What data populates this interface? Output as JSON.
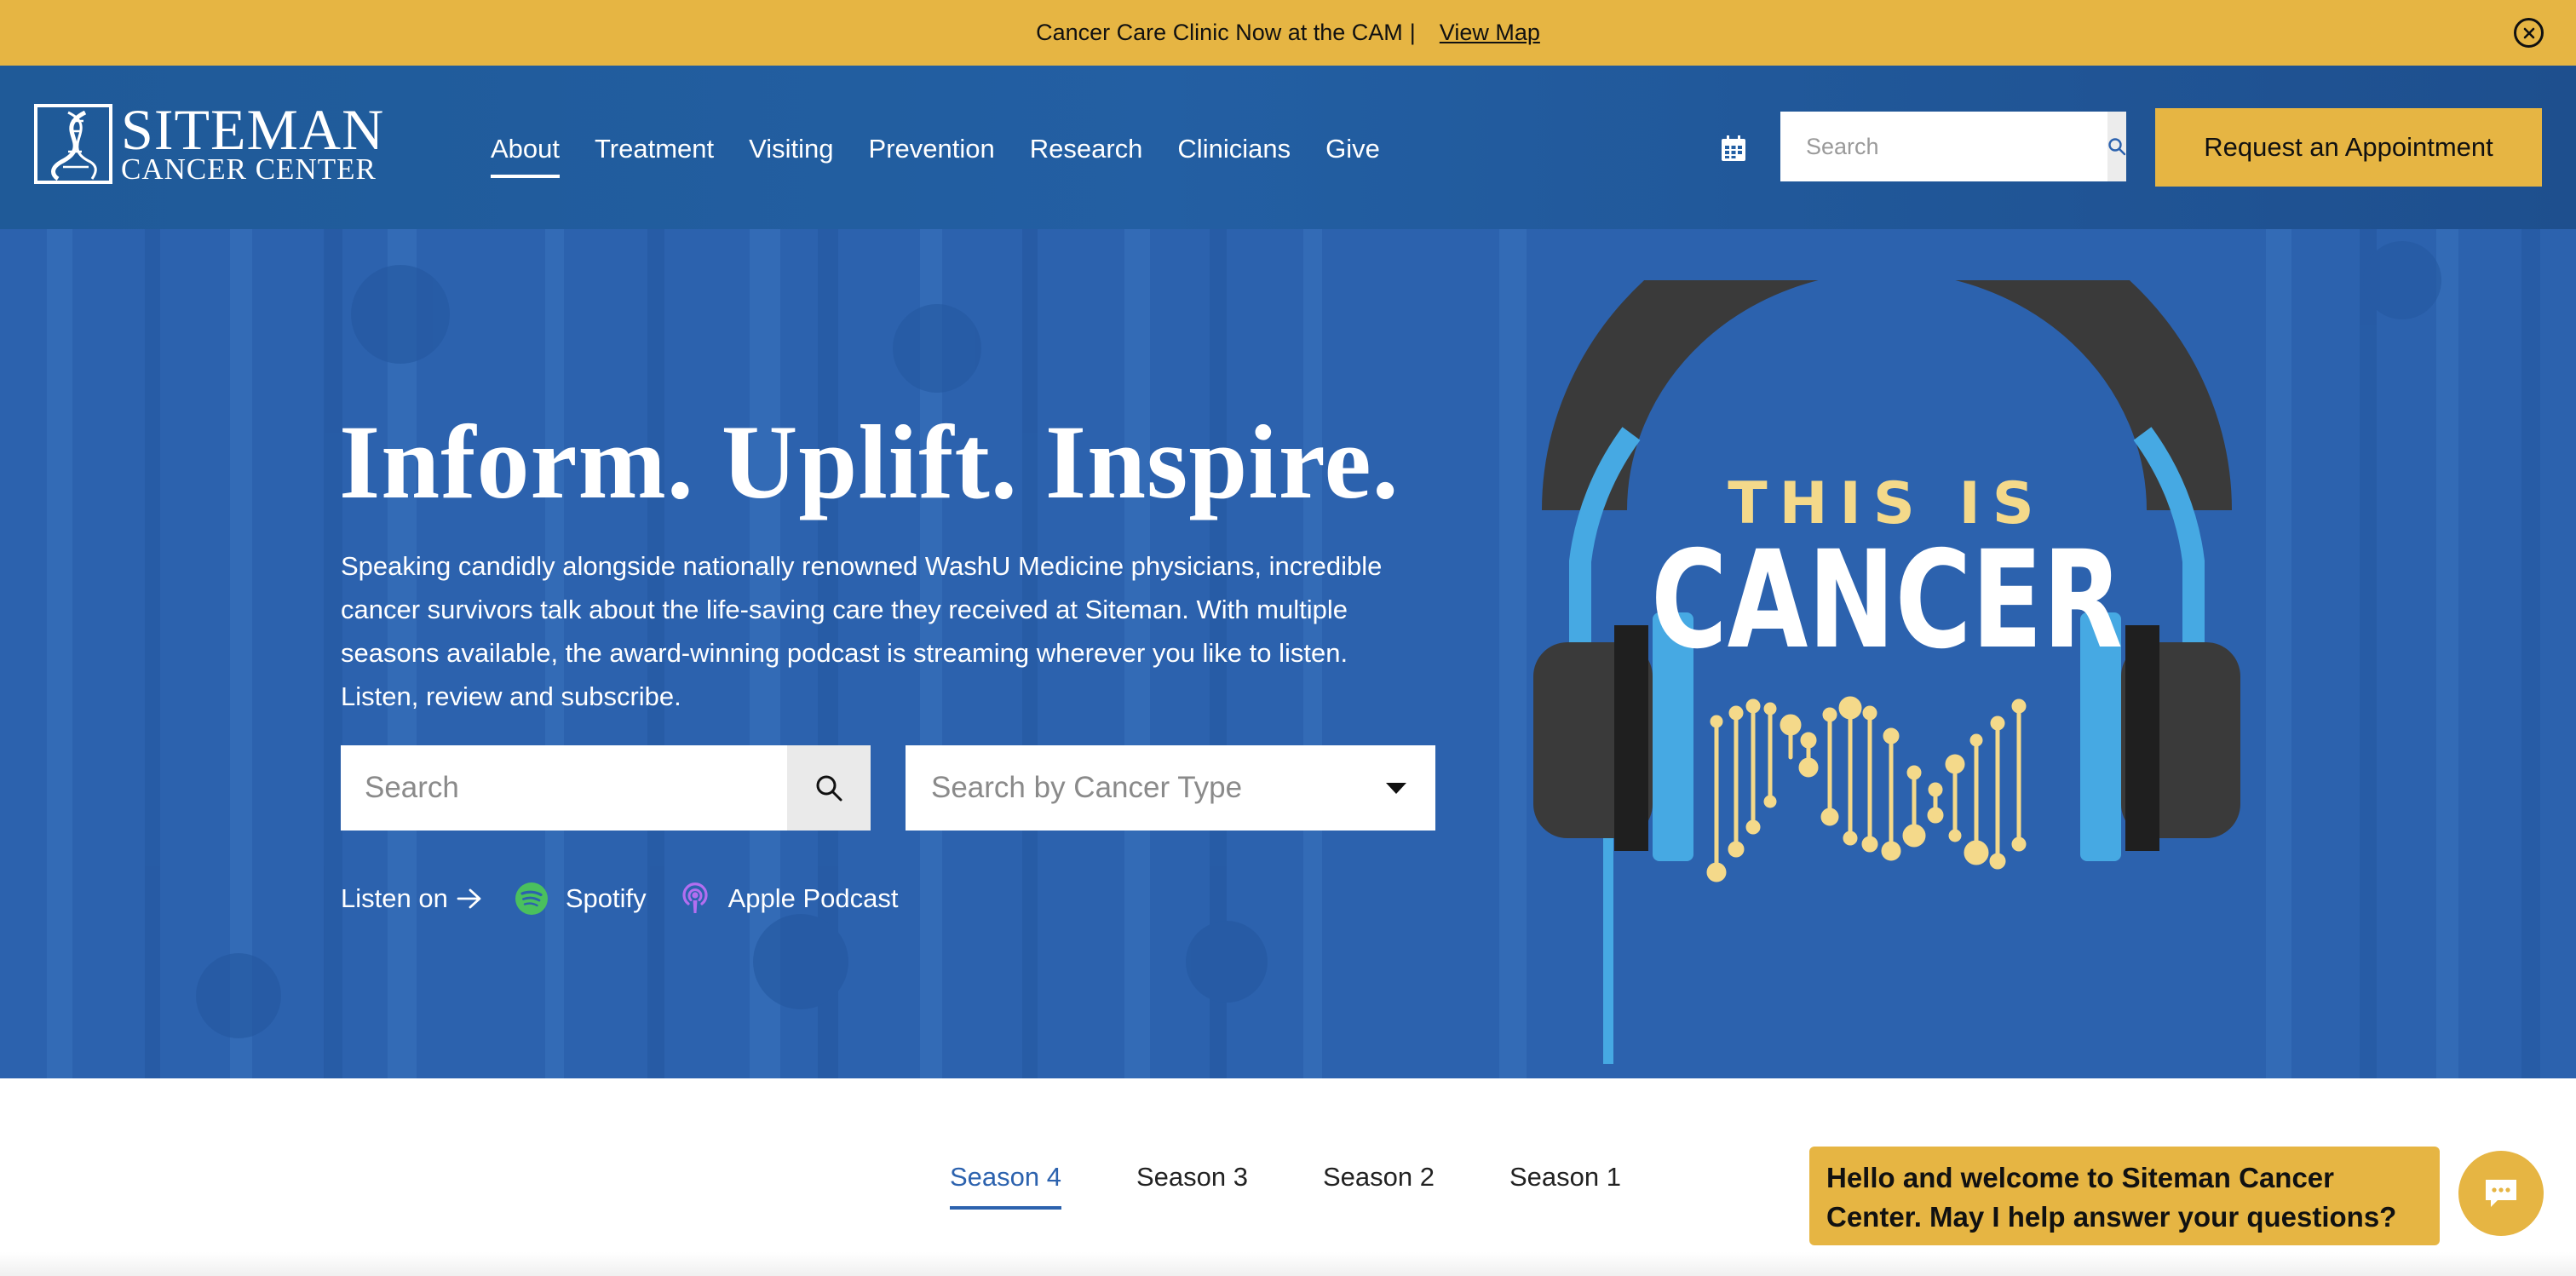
{
  "banner": {
    "text": "Cancer Care Clinic Now at the CAM",
    "separator": "|",
    "link": "View Map",
    "close_icon": "close-circle-icon"
  },
  "header": {
    "logo": {
      "line1": "SITEMAN",
      "line2": "CANCER CENTER"
    },
    "nav": [
      {
        "label": "About",
        "active": true
      },
      {
        "label": "Treatment"
      },
      {
        "label": "Visiting"
      },
      {
        "label": "Prevention"
      },
      {
        "label": "Research"
      },
      {
        "label": "Clinicians"
      },
      {
        "label": "Give"
      }
    ],
    "calendar_icon": "calendar-icon",
    "search": {
      "placeholder": "Search"
    },
    "appointment_button": "Request an Appointment"
  },
  "hero": {
    "title": "Inform. Uplift. Inspire.",
    "description": "Speaking candidly alongside nationally renowned WashU Medicine physicians, incredible cancer survivors talk about the life-saving care they received at Siteman. With multiple seasons available, the award-winning podcast is streaming wherever you like to listen. Listen, review and subscribe.",
    "search": {
      "placeholder": "Search"
    },
    "cancer_type_select": {
      "placeholder": "Search by Cancer Type"
    },
    "listen_on": "Listen on",
    "platforms": [
      {
        "label": "Spotify",
        "icon": "spotify-icon"
      },
      {
        "label": "Apple Podcast",
        "icon": "apple-podcast-icon"
      }
    ],
    "podcast_art": {
      "line1": "THIS IS",
      "line2": "CANCER"
    }
  },
  "seasons": {
    "tabs": [
      {
        "label": "Season 4",
        "active": true
      },
      {
        "label": "Season 3"
      },
      {
        "label": "Season 2"
      },
      {
        "label": "Season 1"
      }
    ]
  },
  "chat": {
    "message": "Hello and welcome to Siteman Cancer Center. May I help answer your questions?",
    "icon": "chat-icon"
  },
  "colors": {
    "accent_gold": "#e6b543",
    "header_blue": "#235fa3",
    "hero_blue": "#2c62ae",
    "spotify_green": "#4ac05e",
    "podcast_purple": "#b36ef0"
  }
}
